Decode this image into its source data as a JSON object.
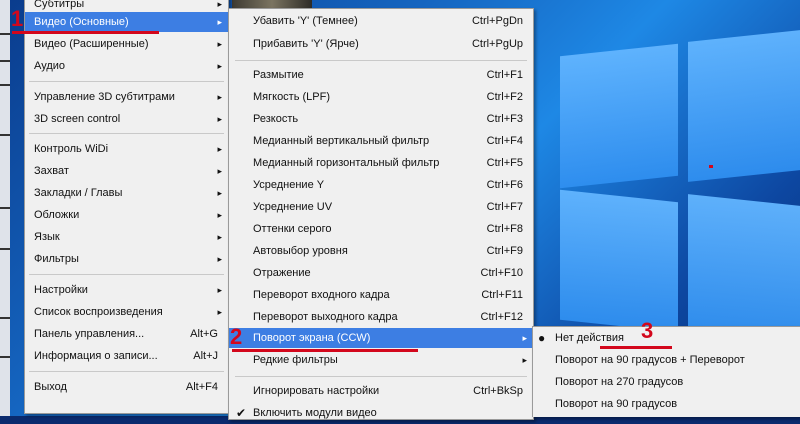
{
  "menu1": {
    "items": [
      {
        "label": "Субтитры",
        "arrow": "▸"
      },
      {
        "label": "Видео (Основные)",
        "arrow": "▸"
      },
      {
        "label": "Видео (Расширенные)",
        "arrow": "▸"
      },
      {
        "label": "Аудио",
        "arrow": "▸"
      },
      {
        "label": "Управление 3D субтитрами",
        "arrow": "▸"
      },
      {
        "label": "3D screen control",
        "arrow": "▸"
      },
      {
        "label": "Контроль WiDi",
        "arrow": "▸"
      },
      {
        "label": "Захват",
        "arrow": "▸"
      },
      {
        "label": "Закладки / Главы",
        "arrow": "▸"
      },
      {
        "label": "Обложки",
        "arrow": "▸"
      },
      {
        "label": "Язык",
        "arrow": "▸"
      },
      {
        "label": "Фильтры",
        "arrow": "▸"
      },
      {
        "label": "Настройки",
        "arrow": "▸"
      },
      {
        "label": "Список воспроизведения",
        "arrow": "▸"
      },
      {
        "label": "Панель управления...",
        "shortcut": "Alt+G"
      },
      {
        "label": "Информация о записи...",
        "shortcut": "Alt+J"
      },
      {
        "label": "Выход",
        "shortcut": "Alt+F4"
      }
    ]
  },
  "menu2": {
    "items": [
      {
        "label": "Убавить 'Y' (Темнее)",
        "shortcut": "Ctrl+PgDn"
      },
      {
        "label": "Прибавить 'Y' (Ярче)",
        "shortcut": "Ctrl+PgUp"
      },
      {
        "label": "Размытие",
        "shortcut": "Ctrl+F1"
      },
      {
        "label": "Мягкость (LPF)",
        "shortcut": "Ctrl+F2"
      },
      {
        "label": "Резкость",
        "shortcut": "Ctrl+F3"
      },
      {
        "label": "Медианный вертикальный фильтр",
        "shortcut": "Ctrl+F4"
      },
      {
        "label": "Медианный горизонтальный фильтр",
        "shortcut": "Ctrl+F5"
      },
      {
        "label": "Усреднение Y",
        "shortcut": "Ctrl+F6"
      },
      {
        "label": "Усреднение UV",
        "shortcut": "Ctrl+F7"
      },
      {
        "label": "Оттенки серого",
        "shortcut": "Ctrl+F8"
      },
      {
        "label": "Автовыбор уровня",
        "shortcut": "Ctrl+F9"
      },
      {
        "label": "Отражение",
        "shortcut": "Ctrl+F10"
      },
      {
        "label": "Переворот входного кадра",
        "shortcut": "Ctrl+F11"
      },
      {
        "label": "Переворот выходного кадра",
        "shortcut": "Ctrl+F12"
      },
      {
        "label": "Поворот экрана (CCW)",
        "arrow": "▸"
      },
      {
        "label": "Редкие фильтры",
        "arrow": "▸"
      },
      {
        "label": "Игнорировать настройки",
        "shortcut": "Ctrl+BkSp"
      },
      {
        "label": "Включить модули видео",
        "check": "✔"
      }
    ]
  },
  "menu3": {
    "items": [
      {
        "label": "Нет действия",
        "bullet": "●"
      },
      {
        "label": "Поворот на 90 градусов + Переворот"
      },
      {
        "label": "Поворот на 270 градусов"
      },
      {
        "label": "Поворот на 90 градусов"
      }
    ]
  },
  "annotations": {
    "n1": "1",
    "n2": "2",
    "n3": "3"
  },
  "colors": {
    "highlight": "#3d7ee3",
    "annotation": "#d3071c",
    "menu_bg": "#f0f0f0"
  }
}
